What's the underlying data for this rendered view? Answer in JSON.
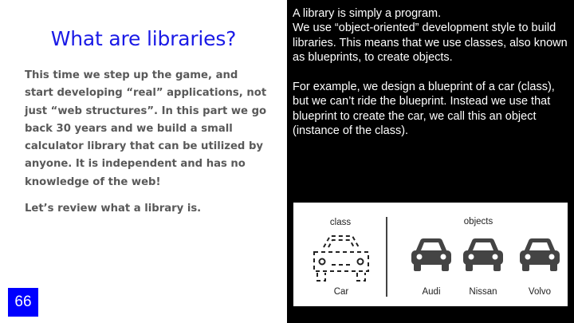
{
  "slide": {
    "title": "What are libraries?",
    "paragraphs": [
      "This time we step up the game, and start developing “real” applications, not just “web structures”. In this part we go back 30 years and we build a small calculator library that can be utilized by anyone.  It is independent and has no knowledge of the web!",
      "Let’s review what a library is."
    ],
    "page_number": "66"
  },
  "explanation": {
    "paragraphs": [
      "A library is simply a program.\nWe use “object-oriented” development style to build libraries. This means that we use classes, also known as blueprints, to create objects.",
      "For example, we design a blueprint of a car (class), but we can’t ride the blueprint. Instead we use that blueprint to create the car, we call this an object (instance of the class)."
    ]
  },
  "diagram": {
    "class_header": "class",
    "objects_header": "objects",
    "class_label": "Car",
    "object_labels": [
      "Audi",
      "Nissan",
      "Volvo"
    ],
    "icons": [
      "car-outline-dashed-icon",
      "car-icon"
    ]
  },
  "colors": {
    "title": "#1a1ae6",
    "body_text": "#595959",
    "page_badge": "#0000ff",
    "right_panel": "#000000"
  }
}
